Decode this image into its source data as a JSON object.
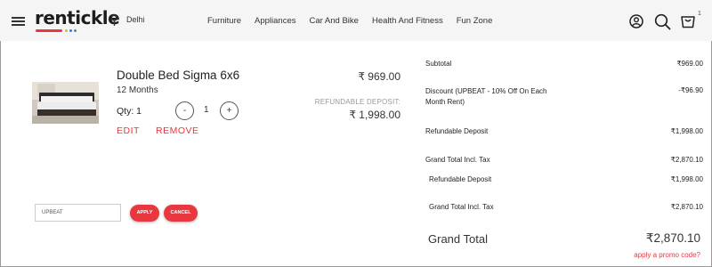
{
  "header": {
    "logo": "rentickle",
    "location": "Delhi",
    "nav": [
      "Furniture",
      "Appliances",
      "Car And Bike",
      "Health And Fitness",
      "Fun Zone"
    ],
    "cart_count": "1"
  },
  "product": {
    "name": "Double Bed Sigma 6x6",
    "duration": "12 Months",
    "qty_label": "Qty: 1",
    "qty_value": "1",
    "minus": "-",
    "plus": "+",
    "edit": "EDIT",
    "remove": "REMOVE",
    "price": "₹  969.00",
    "deposit_label": "REFUNDABLE DEPOSIT:",
    "deposit_value": "₹  1,998.00"
  },
  "promo": {
    "input_value": "UPBEAT",
    "apply": "APPLY",
    "cancel": "CANCEL"
  },
  "summary": {
    "subtotal_label": "Subtotal",
    "subtotal_value": "₹969.00",
    "discount_label": "Discount (UPBEAT - 10% Off On Each Month Rent)",
    "discount_value": "-₹96.90",
    "deposit_label": "Refundable Deposit",
    "deposit_value": "₹1,998.00",
    "gt_tax_label": "Grand Total Incl. Tax",
    "gt_tax_value": "₹2,870.10",
    "deposit_label2": "Refundable Deposit",
    "deposit_value2": "₹1,998.00",
    "gt_tax_label2": "Grand Total Incl. Tax",
    "gt_tax_value2": "₹2,870.10",
    "grand_total_label": "Grand Total",
    "grand_total_value": "₹2,870.10",
    "promo_link": "apply a promo code?"
  },
  "colors": {
    "accent": "#e8373e",
    "header_bg": "#f5f5f5",
    "logo_dots": [
      "#f4b400",
      "#2b7de9",
      "#34a853"
    ]
  },
  "icons": [
    "menu-icon",
    "location-pin-icon",
    "user-icon",
    "search-icon",
    "cart-icon"
  ]
}
